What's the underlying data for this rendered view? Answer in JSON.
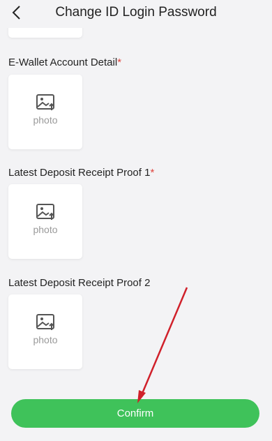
{
  "header": {
    "title": "Change ID Login Password"
  },
  "fields": [
    {
      "label": "E-Wallet Account Detail",
      "required_mark": "*",
      "placeholder": "photo"
    },
    {
      "label": "Latest Deposit Receipt Proof 1",
      "required_mark": "*",
      "placeholder": "photo"
    },
    {
      "label": "Latest Deposit Receipt Proof 2",
      "required_mark": "",
      "placeholder": "photo"
    }
  ],
  "confirm": {
    "label": "Confirm"
  },
  "colors": {
    "accent_green": "#3fc25a",
    "required_red": "#e0453e",
    "annotation_arrow": "#d0202a"
  }
}
